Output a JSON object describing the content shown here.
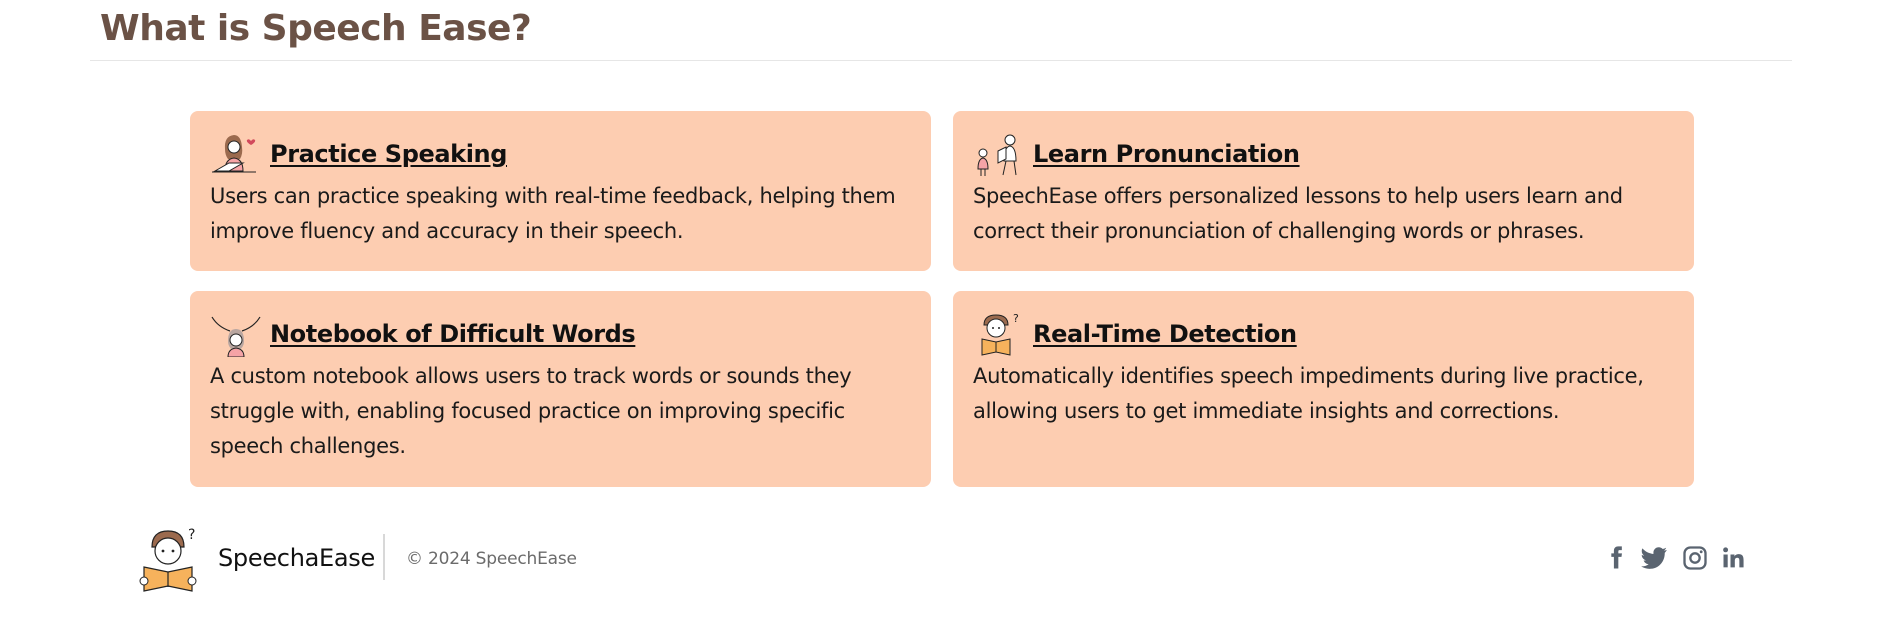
{
  "header": {
    "title": "What is Speech Ease?"
  },
  "features": [
    {
      "icon": "girl-laptop-icon",
      "title": "Practice Speaking",
      "description": "Users can practice speaking with real-time feedback, helping them improve fluency and accuracy in their speech."
    },
    {
      "icon": "teacher-student-icon",
      "title": "Learn Pronunciation",
      "description": "SpeechEase offers personalized lessons to help users learn and correct their pronunciation of challenging words or phrases."
    },
    {
      "icon": "thinking-girl-icon",
      "title": "Notebook of Difficult Words",
      "description": "A custom notebook allows users to track words or sounds they struggle with, enabling focused practice on improving specific speech challenges."
    },
    {
      "icon": "reading-boy-icon",
      "title": "Real-Time Detection",
      "description": "Automatically identifies speech impediments during live practice, allowing users to get immediate insights and corrections."
    }
  ],
  "footer": {
    "logo_icon": "reading-boy-logo-icon",
    "brand": "SpeechaEase",
    "copyright": "© 2024 SpeechEase",
    "social": [
      "facebook-icon",
      "twitter-icon",
      "instagram-icon",
      "linkedin-icon"
    ]
  },
  "colors": {
    "title": "#6b5246",
    "card_background": "#fdcdb1",
    "social_icon": "#5a6470"
  }
}
